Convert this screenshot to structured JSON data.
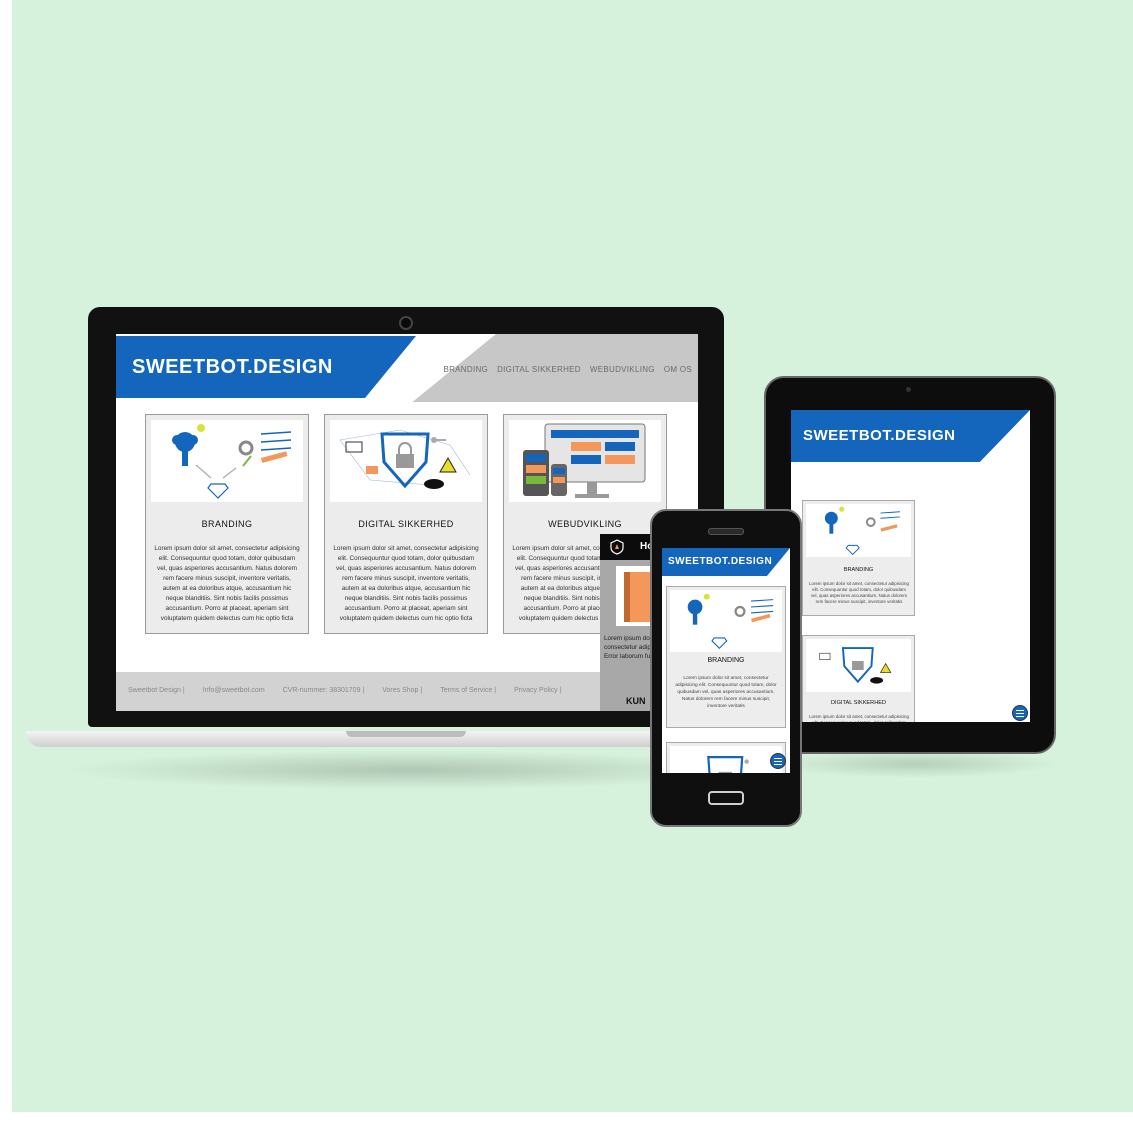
{
  "site": {
    "logo": "SWEETBOT.DESIGN",
    "nav": [
      "BRANDING",
      "DIGITAL SIKKERHED",
      "WEBUDVIKLING",
      "OM OS"
    ]
  },
  "cards": [
    {
      "title": "BRANDING",
      "text": "Lorem ipsum dolor sit amet, consectetur adipisicing elit. Consequuntur quod totam, dolor quibusdam vel, quas asperiores accusantium. Natus dolorem rem facere minus suscipit, inventore veritatis, autem at ea doloribus atque, accusantium hic neque blanditiis. Sint nobis facilis possimus accusantium. Porro at placeat, aperiam sint voluptatem quidem delectus cum hic optio ficta"
    },
    {
      "title": "DIGITAL SIKKERHED",
      "text": "Lorem ipsum dolor sit amet, consectetur adipisicing elit. Consequuntur quod totam, dolor quibusdam vel, quas asperiores accusantium. Natus dolorem rem facere minus suscipit, inventore veritatis, autem at ea doloribus atque, accusantium hic neque blanditiis. Sint nobis facilis possimus accusantium. Porro at placeat, aperiam sint voluptatem quidem delectus cum hic optio ficta"
    },
    {
      "title": "WEBUDVIKLING",
      "text": "Lorem ipsum dolor sit amet, consectetur adipisicing elit. Consequuntur quod totam, dolor quibusdam vel, quas asperiores accusantium. Natus dolorem rem facere minus suscipit, inventore veritatis, autem at ea doloribus atque, accusantium hic neque blanditiis. Sint nobis facilis possimus accusantium. Porro at placeat, aperiam sint voluptatem quidem delectus cum hic optio ficta"
    }
  ],
  "footer": [
    "Sweetbot Design |",
    "Info@sweetbot.com",
    "CVR-nummer: 38301709 |",
    "Vores Shop |",
    "Terms of Service |",
    "Privacy Policy |"
  ],
  "popup": {
    "title": "Ho",
    "text": "Lorem ipsum dolor sit amet, consectetur adipisicing elit. Error laborum fuga, consequ",
    "cta": "KUN"
  },
  "mobile_card_text": "Lorem ipsum dolor sit amet, consectetur adipisicing elit. Consequuntur quod totam, dolor quibusdam vel, quas asperiores accusantium. Natus dolorem rem facere minus suscipit, inventore veritatis",
  "colors": {
    "brand_blue": "#1466bd",
    "accent_orange": "#f3975a",
    "background": "#d6f2dc",
    "device_black": "#111111"
  }
}
